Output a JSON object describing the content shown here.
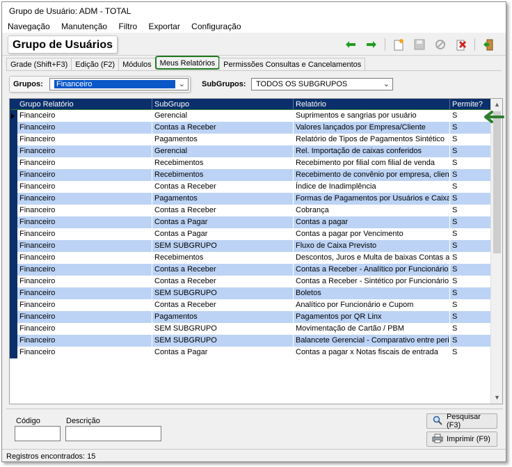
{
  "window": {
    "title": "Grupo de Usuário: ADM - TOTAL"
  },
  "menu": [
    "Navegação",
    "Manutenção",
    "Filtro",
    "Exportar",
    "Configuração"
  ],
  "page_title": "Grupo de Usuários",
  "toolbar": {
    "icons": [
      "arrow-left-icon",
      "arrow-right-icon",
      "new-document-icon",
      "save-icon",
      "cancel-icon",
      "delete-icon",
      "exit-icon"
    ],
    "colors": {
      "arrow": "#1e9e1e",
      "delete": "#d42020"
    }
  },
  "tabs": [
    {
      "label": "Grade (Shift+F3)"
    },
    {
      "label": "Edição (F2)"
    },
    {
      "label": "Módulos"
    },
    {
      "label": "Meus Relatórios"
    },
    {
      "label": "Permissões Consultas e Cancelamentos"
    }
  ],
  "filters": {
    "grupos_label": "Grupos:",
    "grupos_value": "Financeiro",
    "subgrupos_label": "SubGrupos:",
    "subgrupos_value": "TODOS OS SUBGRUPOS"
  },
  "grid": {
    "columns": [
      "Grupo Relatório",
      "SubGrupo",
      "Relatório",
      "Permite?"
    ],
    "rows": [
      [
        "Financeiro",
        "Gerencial",
        "Suprimentos e sangrias por usuário",
        "S"
      ],
      [
        "Financeiro",
        "Contas a Receber",
        "Valores lançados por Empresa/Cliente",
        "S"
      ],
      [
        "Financeiro",
        "Pagamentos",
        "Relatório de Tipos de Pagamentos Sintético",
        "S"
      ],
      [
        "Financeiro",
        "Gerencial",
        "Rel. Importação de caixas conferidos",
        "S"
      ],
      [
        "Financeiro",
        "Recebimentos",
        "Recebimento por filial com filial de venda",
        "S"
      ],
      [
        "Financeiro",
        "Recebimentos",
        "Recebimento de convênio por empresa, cliente",
        "S"
      ],
      [
        "Financeiro",
        "Contas a Receber",
        "Índice de Inadimplência",
        "S"
      ],
      [
        "Financeiro",
        "Pagamentos",
        "Formas de Pagamentos por Usuários e Caixa",
        "S"
      ],
      [
        "Financeiro",
        "Contas a Receber",
        "Cobrança",
        "S"
      ],
      [
        "Financeiro",
        "Contas a Pagar",
        "Contas a pagar",
        "S"
      ],
      [
        "Financeiro",
        "Contas a Pagar",
        "Contas a pagar por Vencimento",
        "S"
      ],
      [
        "Financeiro",
        "SEM SUBGRUPO",
        "Fluxo de Caixa Previsto",
        "S"
      ],
      [
        "Financeiro",
        "Recebimentos",
        "Descontos, Juros e Multa de baixas Contas a",
        "S"
      ],
      [
        "Financeiro",
        "Contas a Receber",
        "Contas a Receber - Analítico por Funcionário",
        "S"
      ],
      [
        "Financeiro",
        "Contas a Receber",
        "Contas a Receber - Sintético por Funcionário",
        "S"
      ],
      [
        "Financeiro",
        "SEM SUBGRUPO",
        "Boletos",
        "S"
      ],
      [
        "Financeiro",
        "Contas a Receber",
        "Analítico por Funcionário e Cupom",
        "S"
      ],
      [
        "Financeiro",
        "Pagamentos",
        "Pagamentos por QR Linx",
        "S"
      ],
      [
        "Financeiro",
        "SEM SUBGRUPO",
        "Movimentação de Cartão / PBM",
        "S"
      ],
      [
        "Financeiro",
        "SEM SUBGRUPO",
        "Balancete Gerencial - Comparativo entre perio",
        "S"
      ],
      [
        "Financeiro",
        "Contas a Pagar",
        "Contas a pagar x Notas fiscais de entrada",
        "S"
      ]
    ],
    "selected_row": 0,
    "colors": {
      "header": "#0b2f6b",
      "stripe": "#bcd3f5",
      "highlight": "#2d7d2d"
    }
  },
  "bottom": {
    "codigo_label": "Código",
    "descricao_label": "Descrição",
    "pesquisar_label": "Pesquisar (F3)",
    "imprimir_label": "Imprimir (F9)"
  },
  "status": "Registros encontrados: 15"
}
